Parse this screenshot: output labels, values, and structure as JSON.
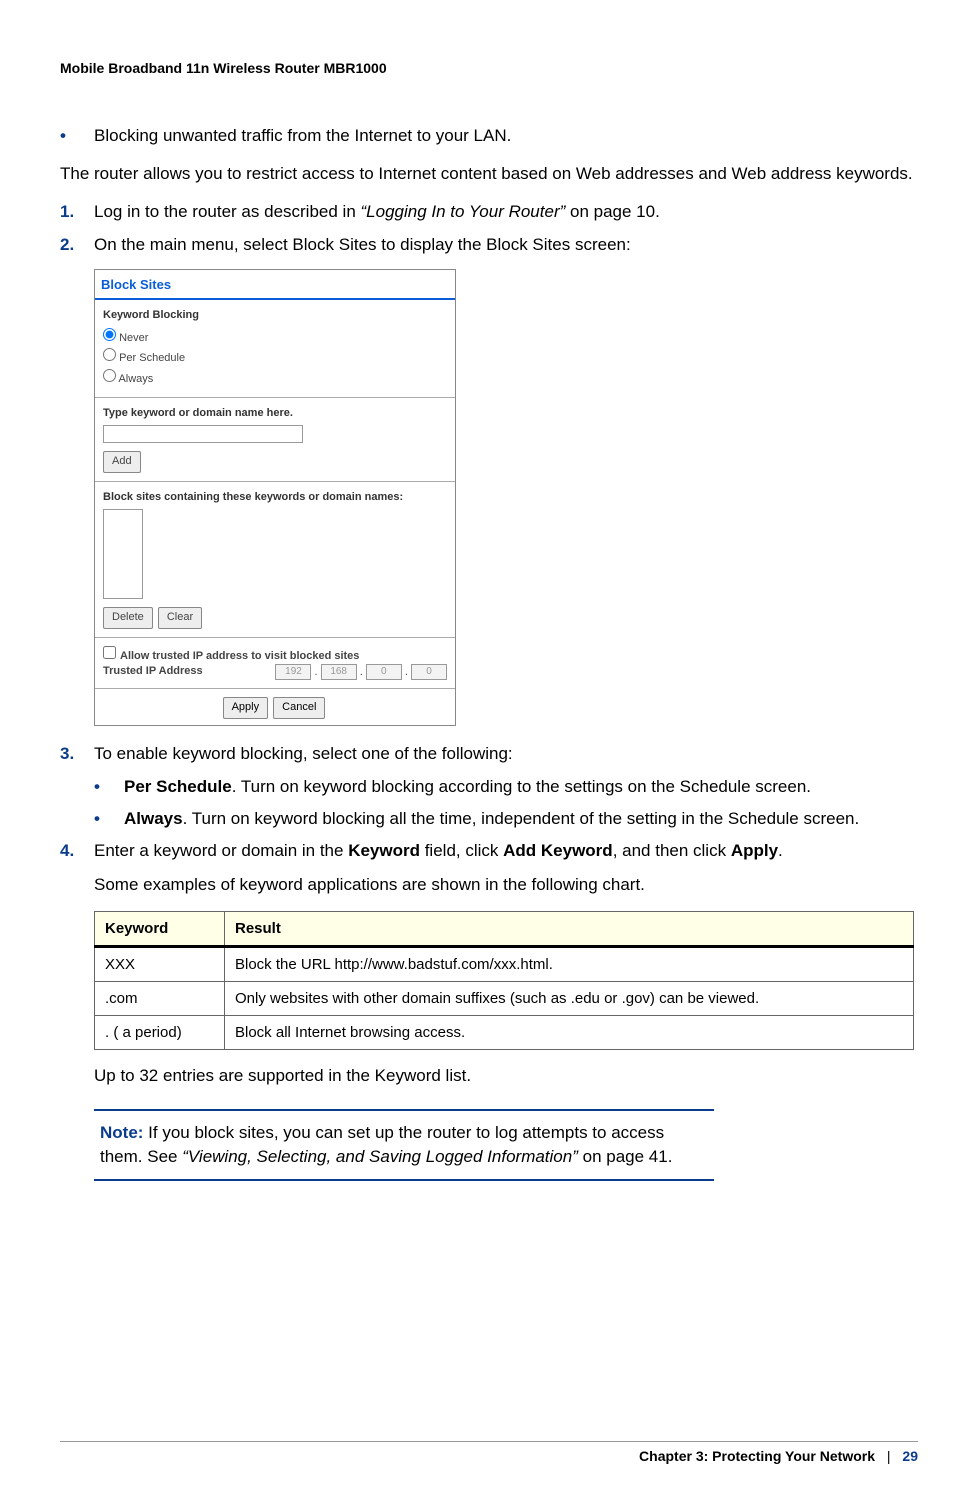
{
  "header": {
    "title": "Mobile Broadband 11n Wireless Router MBR1000"
  },
  "intro_bullet": "Blocking unwanted traffic from the Internet to your LAN.",
  "intro_para": "The router allows you to restrict access to Internet content based on Web addresses and Web address keywords.",
  "steps": {
    "s1_pre": "Log in to the router as described in ",
    "s1_link": "“Logging In to Your Router”",
    "s1_post": " on page 10.",
    "s2": "On the main menu, select Block Sites to display the Block Sites screen:",
    "s3": "To enable keyword blocking, select one of the following:",
    "s3a_lbl": "Per Schedule",
    "s3a_txt": ". Turn on keyword blocking according to the settings on the Schedule screen.",
    "s3b_lbl": "Always",
    "s3b_txt": ". Turn on keyword blocking all the time, independent of the setting in the Schedule screen.",
    "s4_pre": "Enter a keyword or domain in the ",
    "s4_kw": "Keyword",
    "s4_mid1": " field, click ",
    "s4_add": "Add Keyword",
    "s4_mid2": ", and then click ",
    "s4_apply": "Apply",
    "s4_post": ".",
    "s4_para": "Some examples of keyword applications are shown in the following chart."
  },
  "screenshot": {
    "title": "Block Sites",
    "kb_label": "Keyword Blocking",
    "kb_never": "Never",
    "kb_per": "Per Schedule",
    "kb_always": "Always",
    "type_lbl": "Type keyword or domain name here.",
    "add_btn": "Add",
    "list_lbl": "Block sites containing these keywords or domain names:",
    "delete_btn": "Delete",
    "clear_btn": "Clear",
    "trust_chk": "Allow trusted IP address to visit blocked sites",
    "trust_lbl": "Trusted IP Address",
    "ip1": "192",
    "ip2": "168",
    "ip3": "0",
    "ip4": "0",
    "apply_btn": "Apply",
    "cancel_btn": "Cancel"
  },
  "table": {
    "h1": "Keyword",
    "h2": "Result",
    "rows": [
      {
        "k": "XXX",
        "r": "Block the URL http://www.badstuf.com/xxx.html."
      },
      {
        "k": ".com",
        "r": "Only websites with other domain suffixes (such as .edu or .gov) can be viewed."
      },
      {
        "k": ". ( a period)",
        "r": "Block all Internet browsing access."
      }
    ]
  },
  "after_table": "Up to 32 entries are supported in the Keyword list.",
  "note": {
    "label": "Note:",
    "pre": "  If you block sites, you can set up the router to log attempts to access them. See ",
    "link": "“Viewing, Selecting, and Saving Logged Information”",
    "post": " on page 41."
  },
  "footer": {
    "chapter": "Chapter 3:  Protecting Your Network",
    "page": "29"
  }
}
